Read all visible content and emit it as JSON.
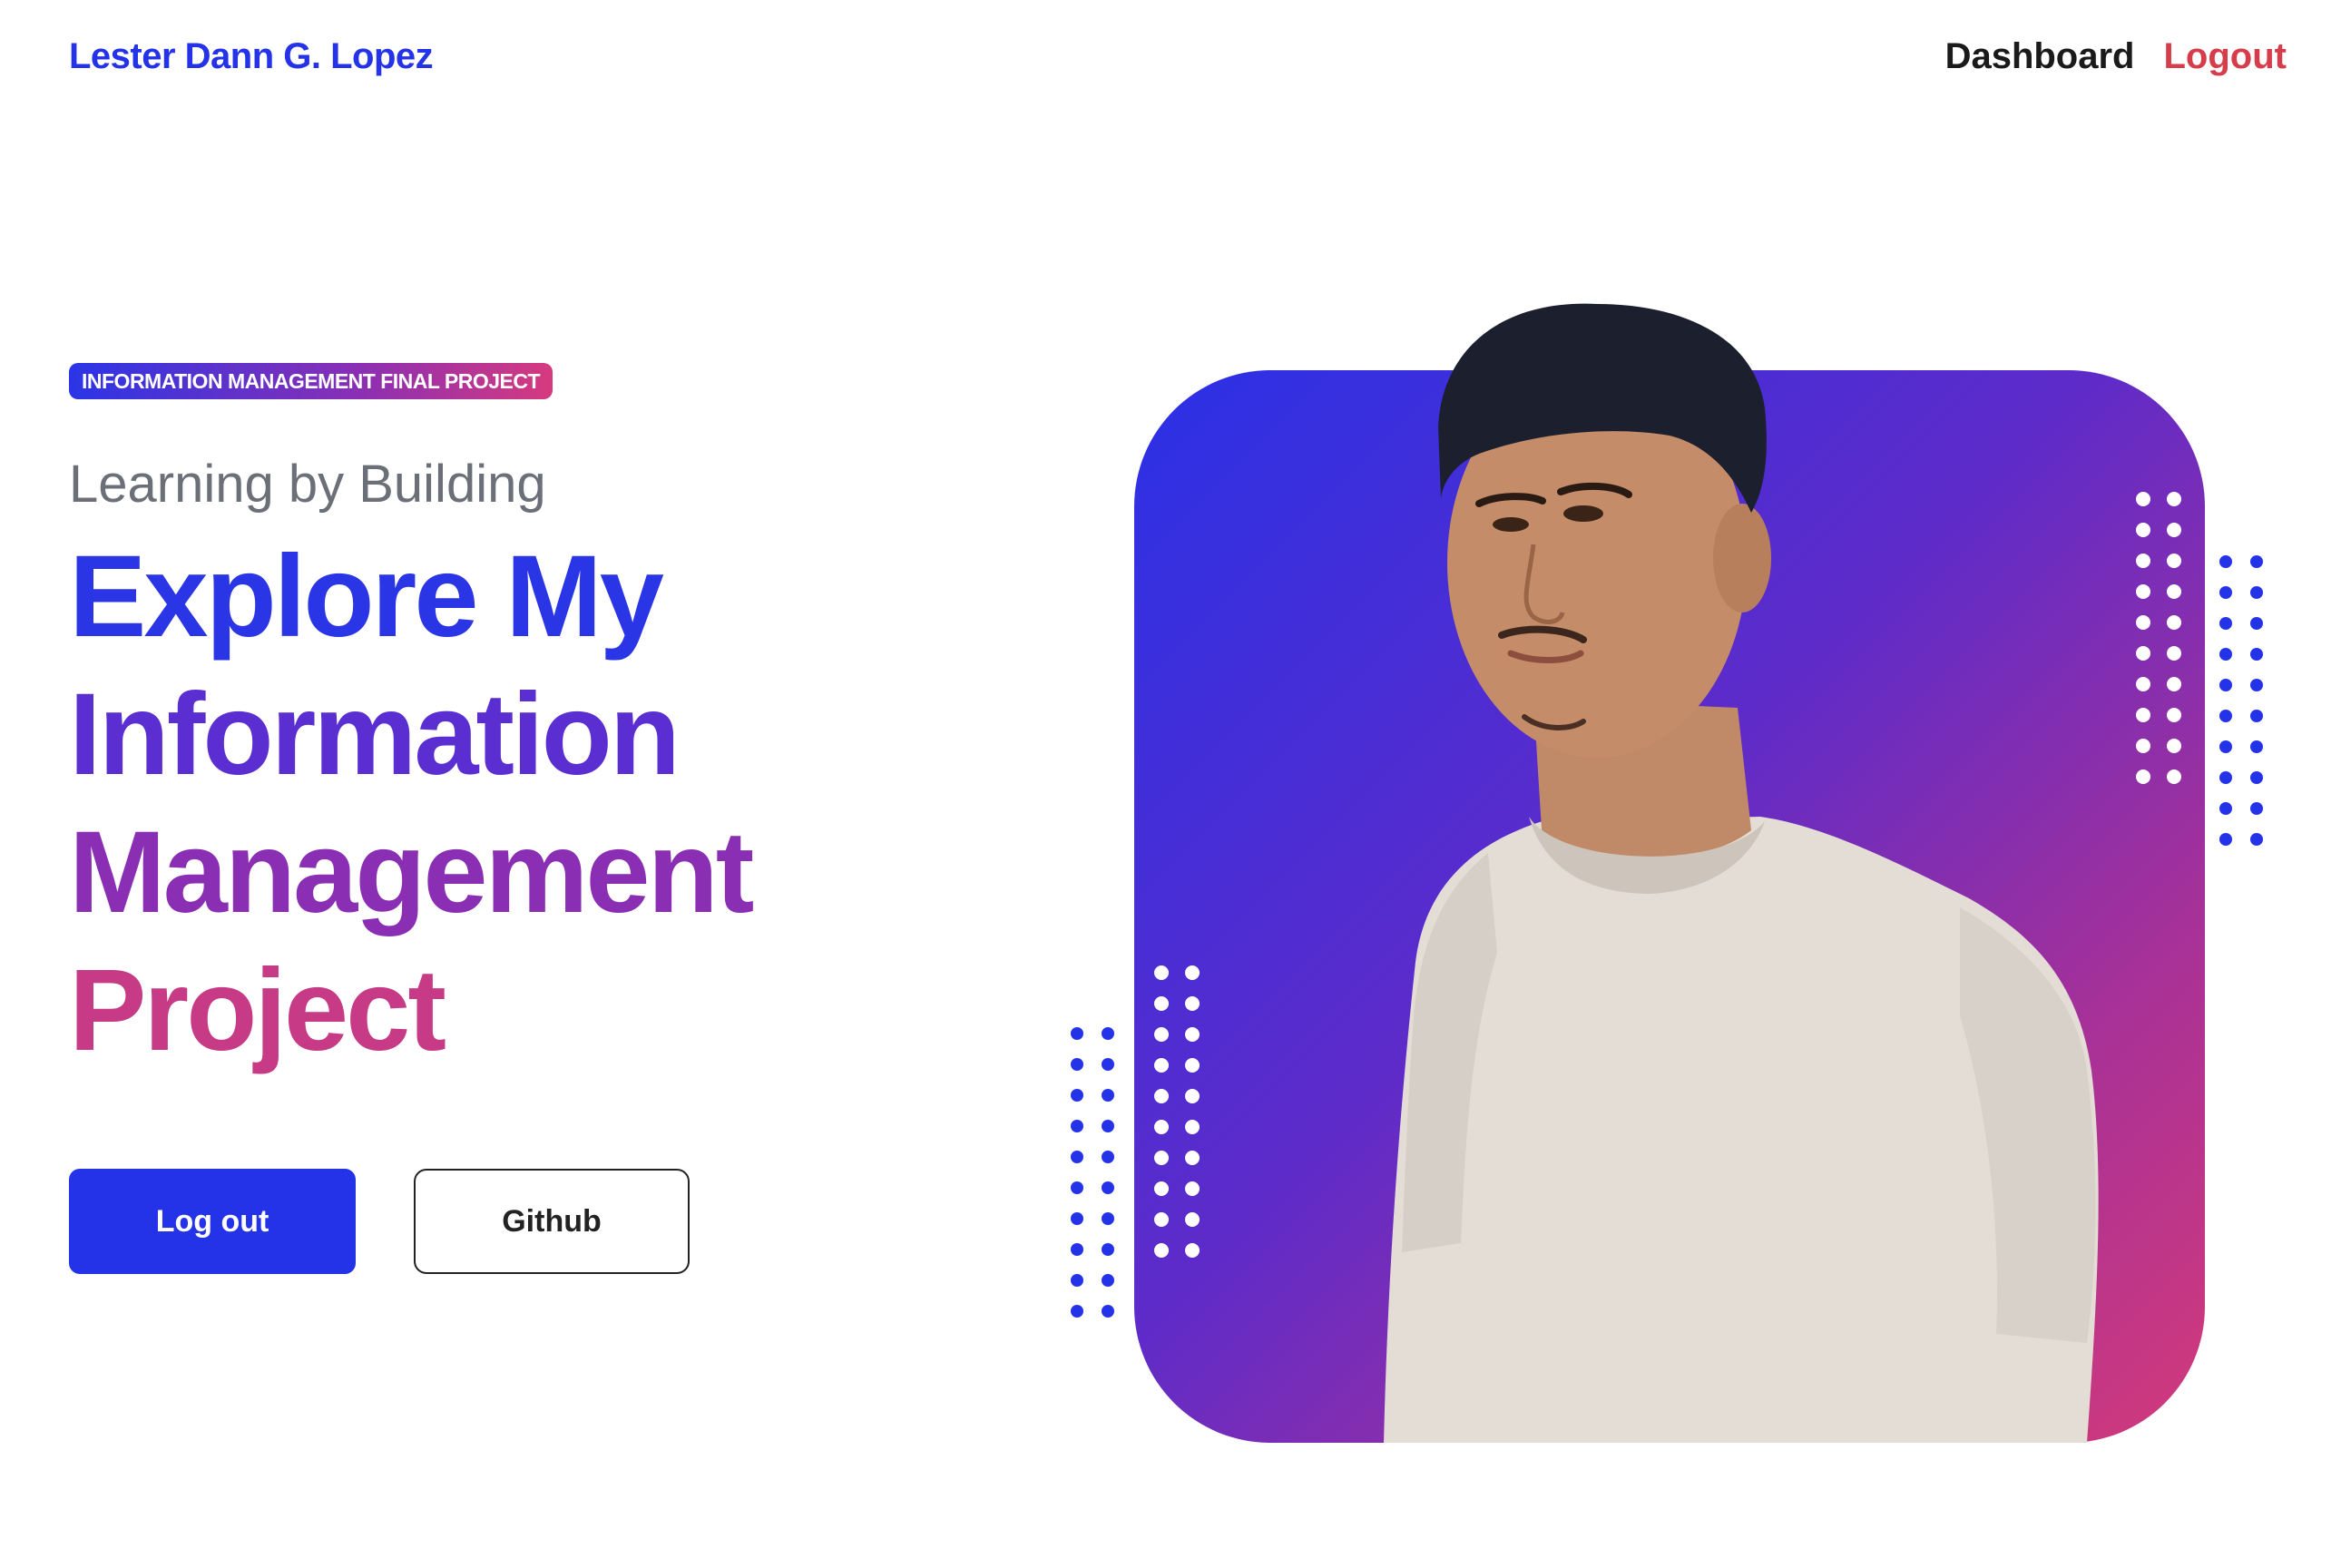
{
  "nav": {
    "brand": "Lester Dann G. Lopez",
    "links": [
      {
        "label": "Dashboard"
      },
      {
        "label": "Logout"
      }
    ]
  },
  "hero": {
    "badge": "INFORMATION MANAGEMENT FINAL PROJECT",
    "subtitle": "Learning by Building",
    "headline_lines": [
      "Explore My",
      "Information",
      "Management",
      "Project"
    ],
    "buttons": {
      "primary": "Log out",
      "secondary": "Github"
    },
    "image": {
      "description_icon": "portrait-photo"
    }
  },
  "colors": {
    "brand_blue": "#2433e8",
    "logout_red": "#d63c4a",
    "gradient_start": "#2a31e6",
    "gradient_end": "#d33a7a"
  }
}
